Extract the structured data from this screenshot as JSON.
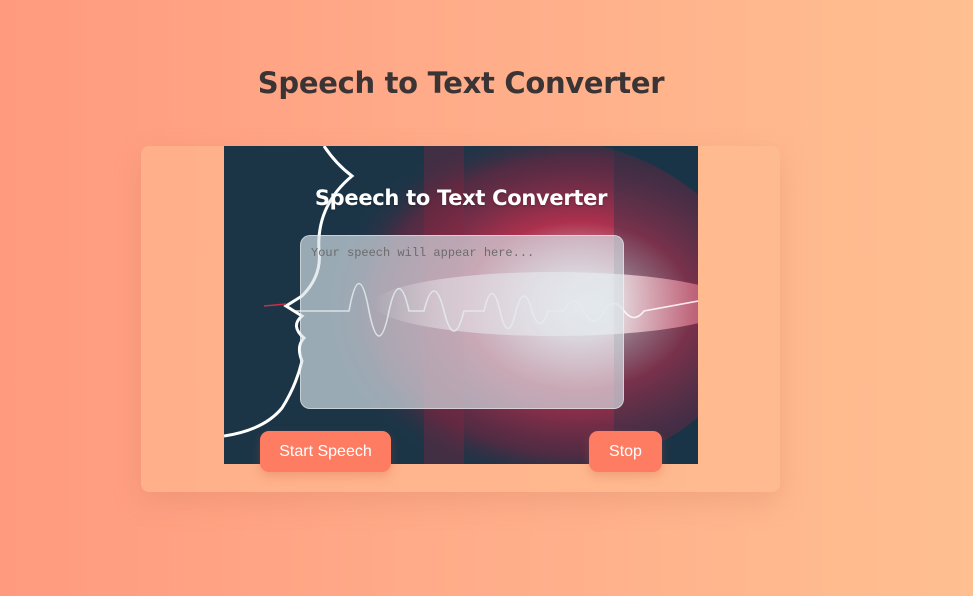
{
  "page": {
    "title": "Speech to Text Converter"
  },
  "hero": {
    "title": "Speech to Text Converter",
    "image_icon": "soundwave-face-illustration"
  },
  "speech_output": {
    "placeholder": "Your speech will appear here...",
    "value": ""
  },
  "controls": {
    "start_label": "Start Speech",
    "stop_label": "Stop"
  },
  "colors": {
    "background_start": "#ff9a7e",
    "background_end": "#ffbf90",
    "button": "#fd7c62",
    "hero_dark": "#1b3547",
    "hero_wave": "#c0304e",
    "title_text": "#3a3434"
  }
}
